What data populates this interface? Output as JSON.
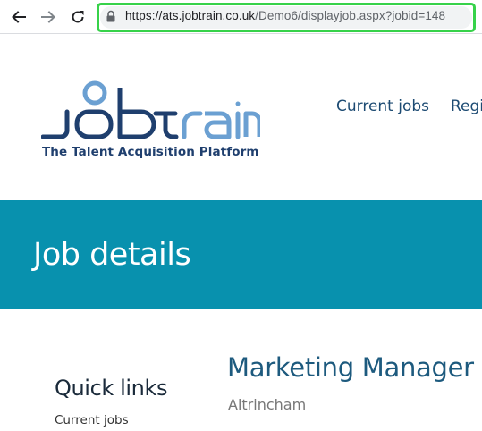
{
  "browser": {
    "url_host": "https://ats.jobtrain.co.uk",
    "url_path": "/Demo6/displayjob.aspx?jobid=148",
    "highlight_color": "#37d24a"
  },
  "header": {
    "logo_text": "JOBTRAIN",
    "tagline": "The Talent Acquisition Platform",
    "nav": [
      {
        "label": "Current jobs"
      },
      {
        "label": "Regi"
      }
    ]
  },
  "banner": {
    "title": "Job details",
    "color": "#0891ae"
  },
  "job": {
    "title": "Marketing Manager",
    "location": "Altrincham"
  },
  "quick_links": {
    "heading": "Quick links",
    "items": [
      {
        "label": "Current jobs"
      }
    ]
  },
  "icons": [
    "back-arrow-icon",
    "forward-arrow-icon",
    "reload-icon",
    "lock-icon"
  ]
}
